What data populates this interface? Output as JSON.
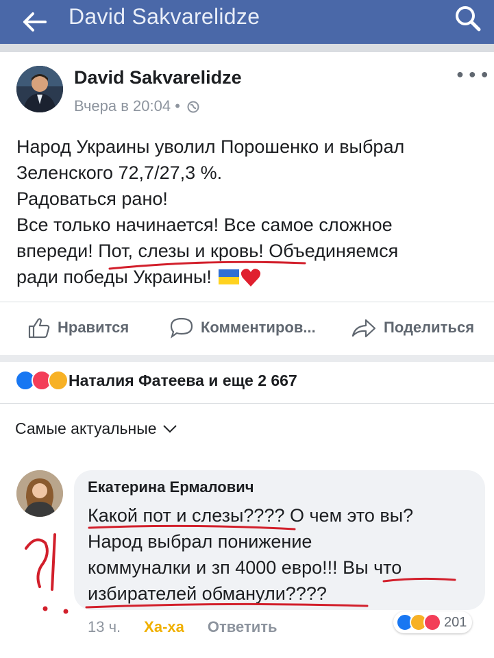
{
  "header": {
    "title": "David Sakvarelidze",
    "back_icon": "arrow-left-icon",
    "search_icon": "search-icon",
    "bg": "#4a68a8"
  },
  "post": {
    "author": "David Sakvarelidze",
    "time": "Вчера в 20:04 •",
    "lines": [
      "Народ Украины уволил Порошенко и выбрал",
      "Зеленского 72,7/27,3 %.",
      "Радоваться рано!",
      "Все только начинается! Все самое сложное",
      "впереди! Пот, слезы и кровь! Объединяемся",
      "ради победы Украины!"
    ]
  },
  "actions": {
    "like": "Нравится",
    "comment": "Комментиров...",
    "share": "Поделиться"
  },
  "reactions": {
    "names": "Наталия Фатеева и еще 2 667"
  },
  "sort": {
    "label": "Самые актуальные"
  },
  "comment": {
    "author": "Екатерина Ермалович",
    "lines": [
      "Какой пот и слезы???? О чем это вы?",
      "Народ выбрал понижение",
      "коммуналки и зп 4000 евро!!! Вы что",
      "избирателей обманули????"
    ],
    "time": "13 ч.",
    "reaction_link": "Ха-ха",
    "reply": "Ответить",
    "reaction_count": "201"
  },
  "colors": {
    "accent": "#4a68a8",
    "like": "#1877f2",
    "love": "#f33e58",
    "haha": "#f7b125",
    "annotation": "#d21f2b"
  }
}
